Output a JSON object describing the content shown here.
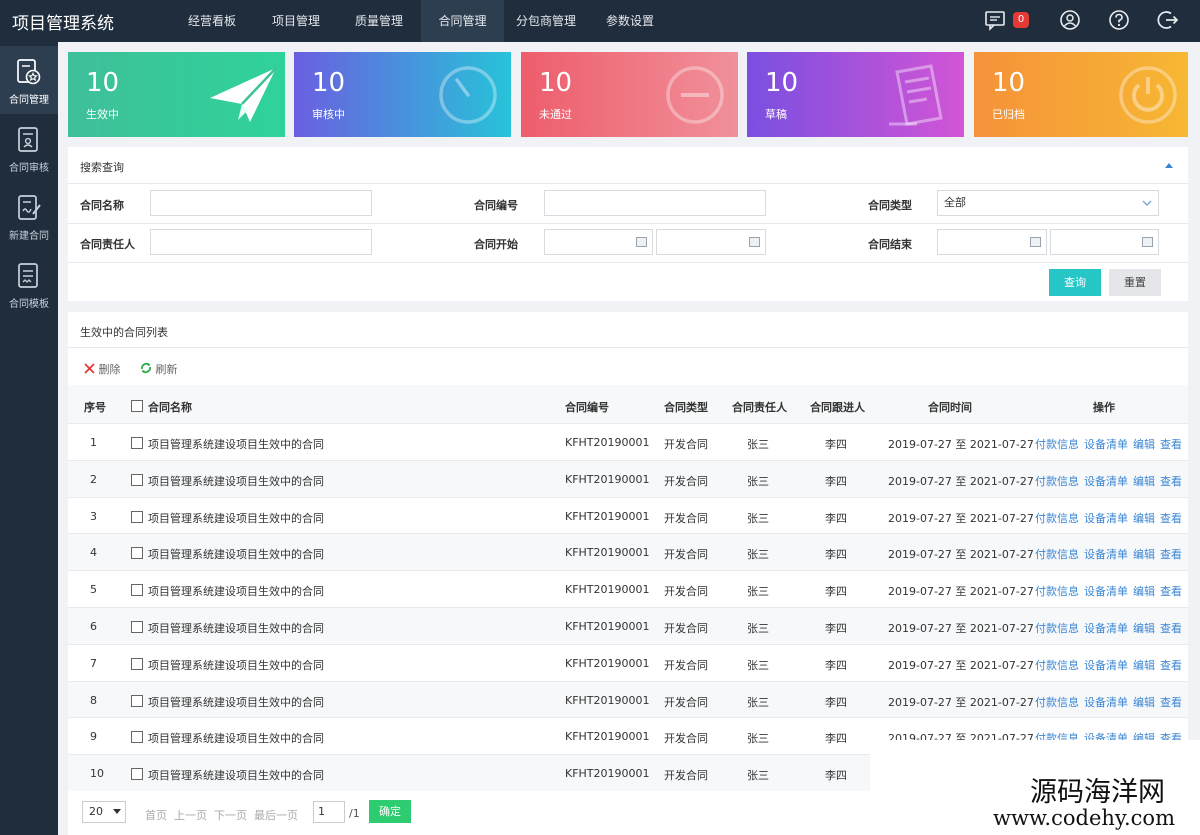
{
  "app_title": "项目管理系统",
  "nav": [
    "经营看板",
    "项目管理",
    "质量管理",
    "合同管理",
    "分包商管理",
    "参数设置"
  ],
  "message_count": "0",
  "sidebar": [
    {
      "label": "合同管理",
      "icon": "contract-star-icon"
    },
    {
      "label": "合同审核",
      "icon": "contract-review-icon"
    },
    {
      "label": "新建合同",
      "icon": "new-contract-icon"
    },
    {
      "label": "合同模板",
      "icon": "contract-template-icon"
    }
  ],
  "stats": [
    {
      "value": "10",
      "label": "生效中",
      "icon": "paper-plane-icon",
      "color_from": "#3fbf9a",
      "color_to": "#2fd39a"
    },
    {
      "value": "10",
      "label": "审核中",
      "icon": "clock-dial-icon",
      "color_from": "#6b5fe0",
      "color_to": "#27c3d9"
    },
    {
      "value": "10",
      "label": "未通过",
      "icon": "minus-circle-icon",
      "color_from": "#ee5d6c",
      "color_to": "#f0909a"
    },
    {
      "value": "10",
      "label": "草稿",
      "icon": "document-pen-icon",
      "color_from": "#7a4fe0",
      "color_to": "#d255d6"
    },
    {
      "value": "10",
      "label": "已归档",
      "icon": "power-icon",
      "color_from": "#f5923a",
      "color_to": "#f7b733"
    }
  ],
  "search": {
    "title": "搜索查询",
    "name_label": "合同名称",
    "code_label": "合同编号",
    "type_label": "合同类型",
    "type_value": "全部",
    "owner_label": "合同责任人",
    "start_label": "合同开始",
    "end_label": "合同结束",
    "query_label": "查询",
    "reset_label": "重置"
  },
  "list": {
    "title": "生效中的合同列表",
    "delete_label": "删除",
    "refresh_label": "刷新",
    "headers": {
      "seq": "序号",
      "name": "合同名称",
      "code": "合同编号",
      "type": "合同类型",
      "owner": "合同责任人",
      "follower": "合同跟进人",
      "time": "合同时间",
      "ops": "操作"
    },
    "ops": [
      "付款信息",
      "设备清单",
      "编辑",
      "查看"
    ],
    "rows": [
      {
        "seq": "1",
        "name": "项目管理系统建设项目生效中的合同",
        "code": "KFHT20190001",
        "type": "开发合同",
        "owner": "张三",
        "follower": "李四",
        "time": "2019-07-27 至 2021-07-27"
      },
      {
        "seq": "2",
        "name": "项目管理系统建设项目生效中的合同",
        "code": "KFHT20190001",
        "type": "开发合同",
        "owner": "张三",
        "follower": "李四",
        "time": "2019-07-27 至 2021-07-27"
      },
      {
        "seq": "3",
        "name": "项目管理系统建设项目生效中的合同",
        "code": "KFHT20190001",
        "type": "开发合同",
        "owner": "张三",
        "follower": "李四",
        "time": "2019-07-27 至 2021-07-27"
      },
      {
        "seq": "4",
        "name": "项目管理系统建设项目生效中的合同",
        "code": "KFHT20190001",
        "type": "开发合同",
        "owner": "张三",
        "follower": "李四",
        "time": "2019-07-27 至 2021-07-27"
      },
      {
        "seq": "5",
        "name": "项目管理系统建设项目生效中的合同",
        "code": "KFHT20190001",
        "type": "开发合同",
        "owner": "张三",
        "follower": "李四",
        "time": "2019-07-27 至 2021-07-27"
      },
      {
        "seq": "6",
        "name": "项目管理系统建设项目生效中的合同",
        "code": "KFHT20190001",
        "type": "开发合同",
        "owner": "张三",
        "follower": "李四",
        "time": "2019-07-27 至 2021-07-27"
      },
      {
        "seq": "7",
        "name": "项目管理系统建设项目生效中的合同",
        "code": "KFHT20190001",
        "type": "开发合同",
        "owner": "张三",
        "follower": "李四",
        "time": "2019-07-27 至 2021-07-27"
      },
      {
        "seq": "8",
        "name": "项目管理系统建设项目生效中的合同",
        "code": "KFHT20190001",
        "type": "开发合同",
        "owner": "张三",
        "follower": "李四",
        "time": "2019-07-27 至 2021-07-27"
      },
      {
        "seq": "9",
        "name": "项目管理系统建设项目生效中的合同",
        "code": "KFHT20190001",
        "type": "开发合同",
        "owner": "张三",
        "follower": "李四",
        "time": "2019-07-27 至 2021-07-27"
      },
      {
        "seq": "10",
        "name": "项目管理系统建设项目生效中的合同",
        "code": "KFHT20190001",
        "type": "开发合同",
        "owner": "张三",
        "follower": "李四",
        "time": ""
      }
    ]
  },
  "pager": {
    "page_size": "20",
    "first": "首页",
    "prev": "上一页",
    "next": "下一页",
    "last": "最后一页",
    "page": "1",
    "total": "/1",
    "confirm": "确定"
  },
  "watermark": {
    "cn": "源码海洋网",
    "url": "www.codehy.com"
  },
  "colors": {
    "topbar": "#1f2d3d",
    "accent": "#26c6c6",
    "link": "#3a86d4",
    "confirm": "#2ecc71"
  }
}
